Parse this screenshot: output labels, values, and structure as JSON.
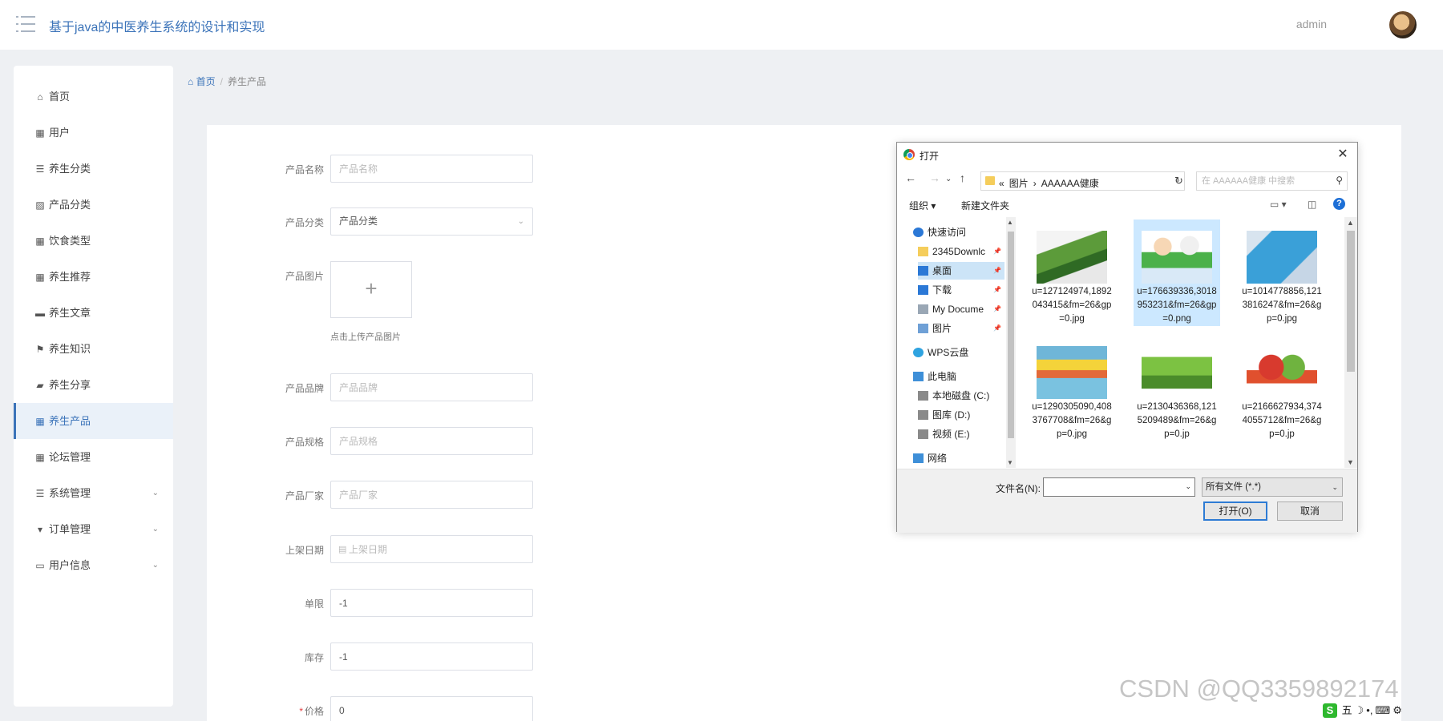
{
  "header": {
    "title": "基于java的中医养生系统的设计和实现",
    "username": "admin"
  },
  "sidebar": {
    "items": [
      {
        "label": "首页",
        "icon": "home-icon",
        "glyph": "⌂"
      },
      {
        "label": "用户",
        "icon": "grid-icon",
        "glyph": "▦"
      },
      {
        "label": "养生分类",
        "icon": "sliders-icon",
        "glyph": "☰"
      },
      {
        "label": "产品分类",
        "icon": "chart-icon",
        "glyph": "▨"
      },
      {
        "label": "饮食类型",
        "icon": "grid-icon",
        "glyph": "▦"
      },
      {
        "label": "养生推荐",
        "icon": "grid-icon",
        "glyph": "▦"
      },
      {
        "label": "养生文章",
        "icon": "book-icon",
        "glyph": "▬"
      },
      {
        "label": "养生知识",
        "icon": "flag-icon",
        "glyph": "⚑"
      },
      {
        "label": "养生分享",
        "icon": "briefcase-icon",
        "glyph": "▰"
      },
      {
        "label": "养生产品",
        "icon": "grid-icon",
        "glyph": "▦",
        "active": true
      },
      {
        "label": "论坛管理",
        "icon": "grid-icon",
        "glyph": "▦"
      },
      {
        "label": "系统管理",
        "icon": "list-icon",
        "glyph": "☰",
        "expandable": true
      },
      {
        "label": "订单管理",
        "icon": "pin-icon",
        "glyph": "▾",
        "expandable": true
      },
      {
        "label": "用户信息",
        "icon": "card-icon",
        "glyph": "▭",
        "expandable": true
      }
    ],
    "chevron": "⌄"
  },
  "breadcrumb": {
    "home": "首页",
    "separator": "/",
    "current": "养生产品",
    "home_glyph": "⌂"
  },
  "form": {
    "name": {
      "label": "产品名称",
      "value": "",
      "placeholder": "产品名称"
    },
    "category": {
      "label": "产品分类",
      "value": "产品分类"
    },
    "image": {
      "label": "产品图片",
      "plus": "+",
      "tip": "点击上传产品图片"
    },
    "brand": {
      "label": "产品品牌",
      "placeholder": "产品品牌"
    },
    "spec": {
      "label": "产品规格",
      "placeholder": "产品规格"
    },
    "maker": {
      "label": "产品厂家",
      "placeholder": "产品厂家"
    },
    "date": {
      "label": "上架日期",
      "placeholder": "上架日期"
    },
    "limit": {
      "label": "单限",
      "value": "-1"
    },
    "stock": {
      "label": "库存",
      "value": "-1"
    },
    "price": {
      "label": "价格",
      "required_mark": "*",
      "value": "0"
    }
  },
  "dialog": {
    "title": "打开",
    "close": "✕",
    "nav": {
      "back": "←",
      "forward": "→",
      "dropdown": "⌄",
      "up": "↑",
      "refresh": "↻"
    },
    "address": {
      "prefix": "«",
      "crumbs": [
        "图片",
        "›",
        "AAAAAA健康"
      ]
    },
    "search": {
      "placeholder": "在 AAAAAA健康 中搜索"
    },
    "toolbar": {
      "organize": "组织 ▾",
      "new_folder": "新建文件夹"
    },
    "tree": [
      {
        "label": "快速访问",
        "icon": "star-icon",
        "level": 0
      },
      {
        "label": "2345Downlc",
        "icon": "folder-icon",
        "level": 1,
        "pinned": true
      },
      {
        "label": "桌面",
        "icon": "desktop-icon",
        "level": 1,
        "pinned": true,
        "selected": true
      },
      {
        "label": "下载",
        "icon": "download-icon",
        "level": 1,
        "pinned": true
      },
      {
        "label": "My Docume",
        "icon": "document-icon",
        "level": 1,
        "pinned": true
      },
      {
        "label": "图片",
        "icon": "pictures-icon",
        "level": 1,
        "pinned": true
      },
      {
        "label": "WPS云盘",
        "icon": "cloud-icon",
        "level": 0
      },
      {
        "label": "此电脑",
        "icon": "computer-icon",
        "level": 0
      },
      {
        "label": "本地磁盘 (C:)",
        "icon": "drive-icon",
        "level": 1
      },
      {
        "label": "图库 (D:)",
        "icon": "drive-icon",
        "level": 1
      },
      {
        "label": "视频 (E:)",
        "icon": "drive-icon",
        "level": 1
      },
      {
        "label": "网络",
        "icon": "network-icon",
        "level": 0
      }
    ],
    "files": [
      {
        "name": "u=127124974,1892043415&fm=26&gp=0.jpg",
        "thumb": "plant"
      },
      {
        "name": "u=176639336,3018953231&fm=26&gp=0.png",
        "thumb": "doctor",
        "selected": true
      },
      {
        "name": "u=1014778856,1213816247&fm=26&gp=0.jpg",
        "thumb": "tablet"
      },
      {
        "name": "u=1290305090,4083767708&fm=26&gp=0.jpg",
        "thumb": "book"
      },
      {
        "name": "u=2130436368,1215209489&fm=26&gp=0.jp",
        "thumb": "food"
      },
      {
        "name": "u=2166627934,3744055712&fm=26&gp=0.jp",
        "thumb": "heart"
      }
    ],
    "filename_label": "文件名(N):",
    "filetype": "所有文件 (*.*)",
    "open_button": "打开(O)",
    "cancel_button": "取消"
  },
  "watermark": "CSDN @QQ3359892174",
  "tray": {
    "logo": "S",
    "items": [
      "五",
      "☽",
      "•,",
      "⌨",
      "⚙"
    ]
  },
  "colors": {
    "accent": "#3b73b9",
    "selection": "#cce8ff",
    "required": "#e4393c"
  }
}
